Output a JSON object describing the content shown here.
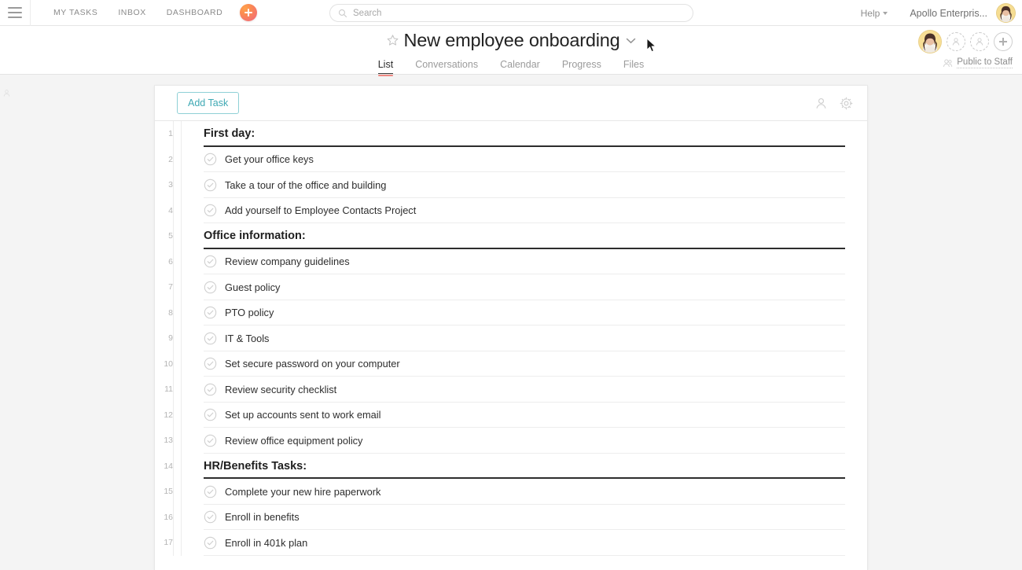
{
  "topbar": {
    "menu_icon": "hamburger-icon",
    "links": [
      "MY TASKS",
      "INBOX",
      "DASHBOARD"
    ],
    "add_button_icon": "plus-icon",
    "search": {
      "placeholder": "Search",
      "value": "",
      "icon": "search-icon"
    },
    "help_label": "Help",
    "org_name": "Apollo Enterpris...",
    "avatar": "user-avatar"
  },
  "project": {
    "star_icon": "star-outline-icon",
    "title": "New employee onboarding",
    "title_caret_icon": "chevron-down-icon",
    "tabs": [
      {
        "label": "List",
        "active": true
      },
      {
        "label": "Conversations",
        "active": false
      },
      {
        "label": "Calendar",
        "active": false
      },
      {
        "label": "Progress",
        "active": false
      },
      {
        "label": "Files",
        "active": false
      }
    ],
    "members": {
      "owner_avatar": "member-avatar",
      "placeholders": [
        "ghost-member-icon",
        "ghost-member-icon"
      ],
      "add_member_icon": "add-member-icon"
    },
    "privacy": {
      "icon": "people-icon",
      "label": "Public to Staff"
    }
  },
  "toolbar": {
    "add_task_label": "Add Task",
    "assignee_icon": "person-icon",
    "settings_icon": "gear-icon"
  },
  "list": {
    "rows": [
      {
        "num": "1",
        "type": "section",
        "text": "First day:"
      },
      {
        "num": "2",
        "type": "task",
        "text": "Get your office keys"
      },
      {
        "num": "3",
        "type": "task",
        "text": "Take a tour of the office and building"
      },
      {
        "num": "4",
        "type": "task",
        "text": "Add yourself to Employee Contacts Project"
      },
      {
        "num": "5",
        "type": "section",
        "text": "Office information:"
      },
      {
        "num": "6",
        "type": "task",
        "text": "Review company guidelines"
      },
      {
        "num": "7",
        "type": "task",
        "text": "Guest policy"
      },
      {
        "num": "8",
        "type": "task",
        "text": "PTO policy"
      },
      {
        "num": "9",
        "type": "task",
        "text": "IT & Tools"
      },
      {
        "num": "10",
        "type": "task",
        "text": "Set secure password on your computer"
      },
      {
        "num": "11",
        "type": "task",
        "text": "Review security checklist"
      },
      {
        "num": "12",
        "type": "task",
        "text": "Set up accounts sent to work email"
      },
      {
        "num": "13",
        "type": "task",
        "text": "Review office equipment policy"
      },
      {
        "num": "14",
        "type": "section",
        "text": "HR/Benefits Tasks:"
      },
      {
        "num": "15",
        "type": "task",
        "text": "Complete your new hire paperwork"
      },
      {
        "num": "16",
        "type": "task",
        "text": "Enroll in benefits"
      },
      {
        "num": "17",
        "type": "task",
        "text": "Enroll in 401k plan"
      }
    ]
  },
  "colors": {
    "accent_teal": "#3fa9b4",
    "accent_red": "#f08a84",
    "add_button_gradient_start": "#ffa24b",
    "add_button_gradient_end": "#ef6c78",
    "page_background": "#f4f4f4",
    "panel_background": "#ffffff"
  }
}
